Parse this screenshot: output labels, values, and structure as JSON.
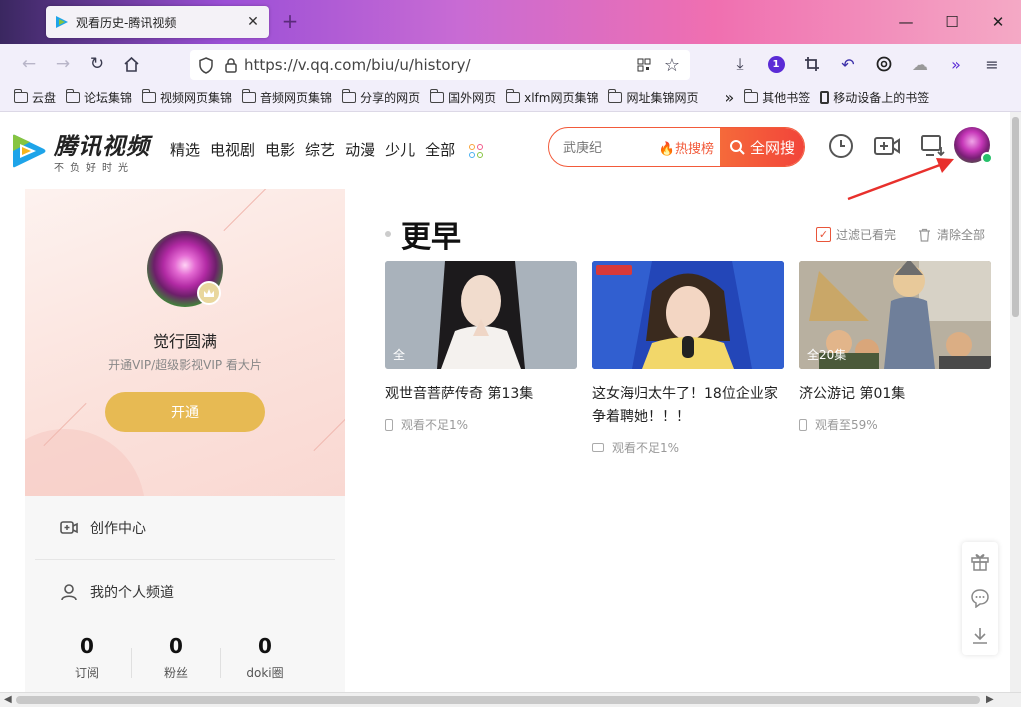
{
  "browser": {
    "tab_title": "观看历史-腾讯视频",
    "url": "https://v.qq.com/biu/u/history/",
    "extension_badge": "1",
    "bookmarks": [
      "云盘",
      "论坛集锦",
      "视频网页集锦",
      "音频网页集锦",
      "分享的网页",
      "国外网页",
      "xlfm网页集锦",
      "网址集锦网页"
    ],
    "bookmarks_other": "其他书签",
    "bookmarks_mobile": "移动设备上的书签"
  },
  "header": {
    "logo_name": "腾讯视频",
    "logo_slogan": "不负好时光",
    "channels": [
      "精选",
      "电视剧",
      "电影",
      "综艺",
      "动漫",
      "少儿",
      "全部"
    ],
    "search_placeholder": "武庚纪",
    "hot_search": "热搜榜",
    "search_button": "全网搜"
  },
  "profile": {
    "username": "觉行圆满",
    "vip_tip": "开通VIP/超级影视VIP 看大片",
    "open_button": "开通"
  },
  "menu": {
    "create_center": "创作中心",
    "my_channel": "我的个人频道",
    "stats": [
      {
        "num": "0",
        "label": "订阅"
      },
      {
        "num": "0",
        "label": "粉丝"
      },
      {
        "num": "0",
        "label": "doki圈"
      }
    ]
  },
  "history": {
    "section_title": "更早",
    "filter_label": "过滤已看完",
    "clear_label": "清除全部",
    "items": [
      {
        "title": "观世音菩萨传奇 第13集",
        "thumb_caption": "全",
        "progress": "观看不足1%",
        "device": "mobile"
      },
      {
        "title": "这女海归太牛了！18位企业家争着聘她！！！",
        "thumb_caption": "",
        "progress": "观看不足1%",
        "device": "pc"
      },
      {
        "title": "济公游记 第01集",
        "thumb_caption": "全20集",
        "progress": "观看至59%",
        "device": "mobile"
      }
    ]
  },
  "colors": {
    "accent": "#f2443a",
    "vip_gold": "#e7ba53",
    "brand_blue": "#1ea4e9",
    "brand_green": "#86c441"
  }
}
